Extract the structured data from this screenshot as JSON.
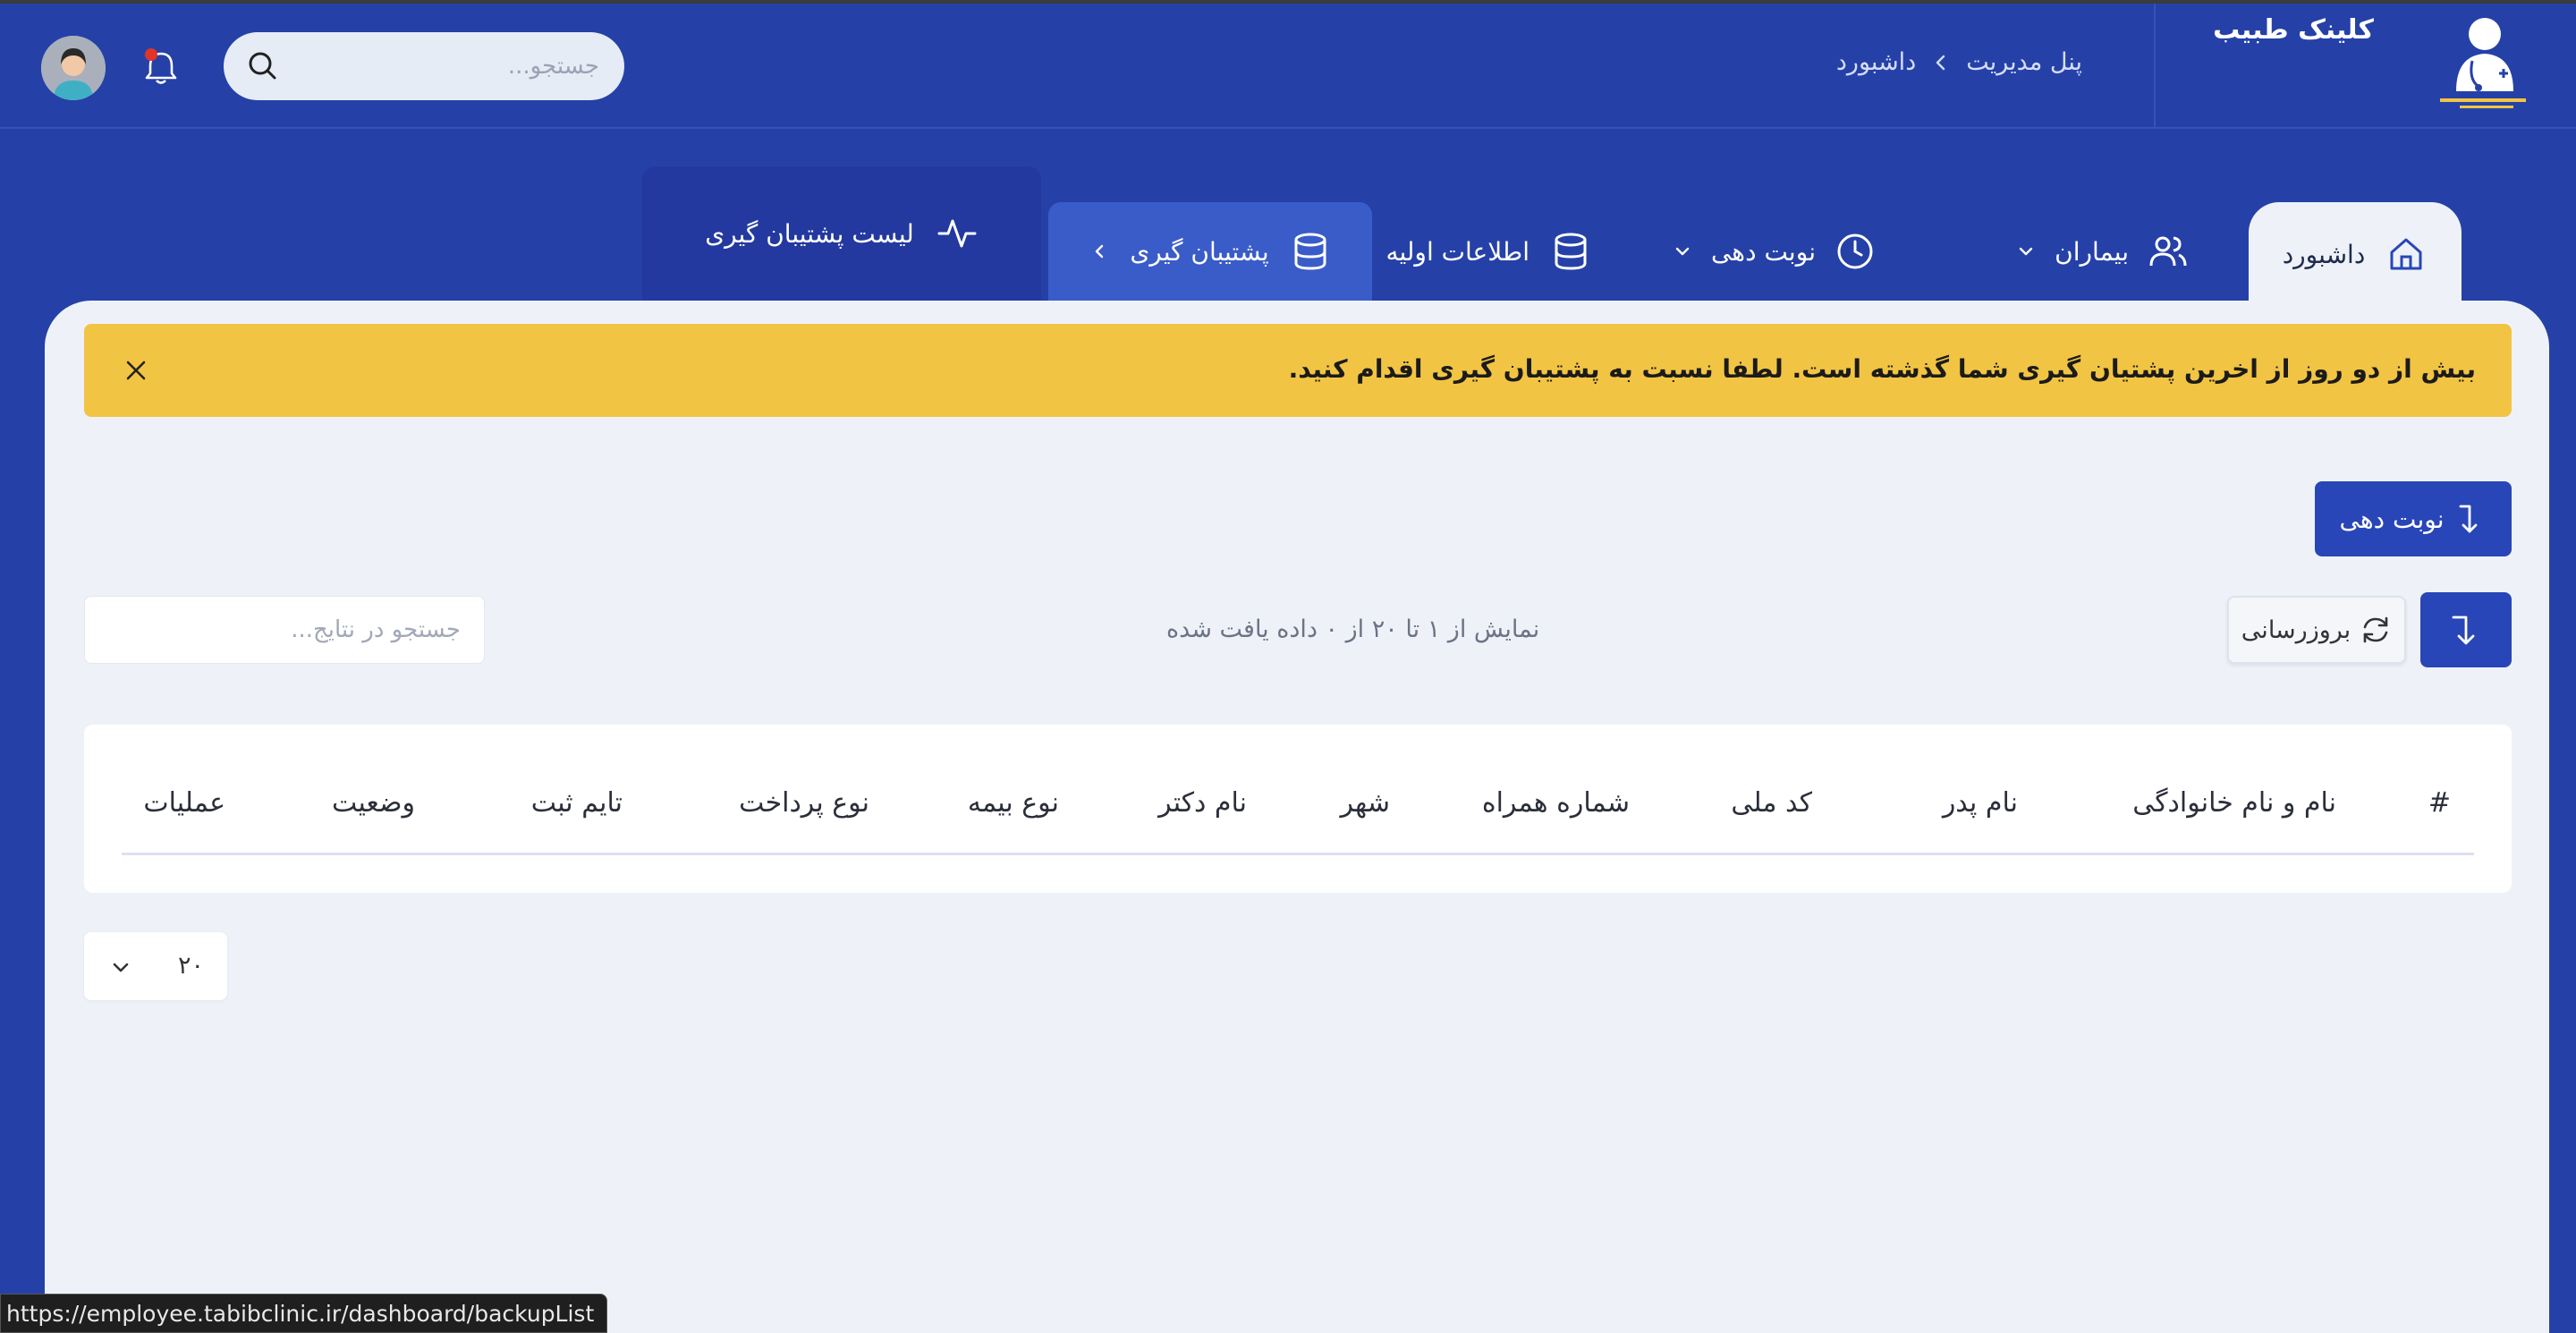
{
  "header": {
    "clinic_name": "کلینک طبیب",
    "breadcrumb": [
      "پنل مدیریت",
      "داشبورد"
    ],
    "search_placeholder": "جستجو..."
  },
  "nav": {
    "tabs": [
      {
        "label": "داشبورد",
        "icon": "home-icon",
        "active": true
      },
      {
        "label": "بیماران",
        "icon": "users-icon"
      },
      {
        "label": "نوبت دهی",
        "icon": "clock-icon"
      },
      {
        "label": "اطلاعات اولیه",
        "icon": "database-icon"
      },
      {
        "label": "پشتیبان گیری",
        "icon": "database-icon"
      },
      {
        "label": "لیست پشتیبان گیری",
        "icon": "activity-icon"
      }
    ]
  },
  "alert": {
    "message": "بیش از دو روز از اخرین پشتیان گیری شما گذشته است. لطفا نسبت به پشتیبان گیری اقدام کنید."
  },
  "actions": {
    "appointment_label": "نوبت دهی",
    "refresh_label": "بروزرسانی"
  },
  "results": {
    "info": "نمایش از ۱ تا ۲۰ از ۰ داده یافت شده",
    "search_placeholder": "جستجو در نتایج..."
  },
  "table": {
    "columns": [
      "#",
      "نام و نام خانوادگی",
      "نام پدر",
      "کد ملی",
      "شماره همراه",
      "شهر",
      "نام دکتر",
      "نوع بیمه",
      "نوع پرداخت",
      "تایم ثبت",
      "وضعیت",
      "عملیات"
    ]
  },
  "pagination": {
    "page_size": "۲۰"
  },
  "status_bar": {
    "url": "https://employee.tabibclinic.ir/dashboard/backupList"
  },
  "colors": {
    "brand": "#2541a8",
    "alert": "#f2c443",
    "panel": "#eef2f8",
    "button": "#2846b8"
  }
}
